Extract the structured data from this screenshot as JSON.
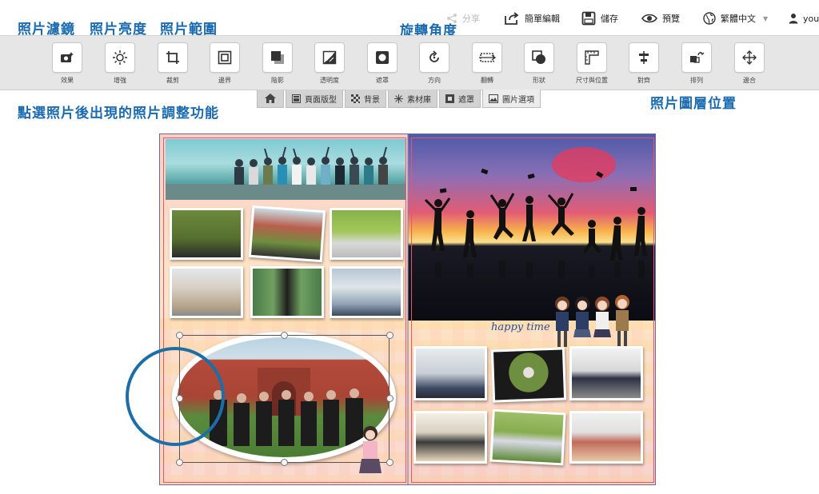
{
  "topbar": {
    "share": "分享",
    "quick_edit": "簡單編輯",
    "save": "儲存",
    "preview": "預覽",
    "language": "繁體中文",
    "user": "you"
  },
  "annotations": {
    "filters": "照片濾鏡",
    "brightness": "照片亮度",
    "range": "照片範圍",
    "rotation": "旋轉角度",
    "adjust": "點選照片後出現的照片調整功能",
    "layer": "照片圖層位置"
  },
  "toolbar": [
    {
      "label": "效果",
      "icon": "camera-effect-icon"
    },
    {
      "label": "增強",
      "icon": "brightness-icon"
    },
    {
      "label": "裁剪",
      "icon": "crop-icon"
    },
    {
      "label": "邊界",
      "icon": "border-icon"
    },
    {
      "label": "陰影",
      "icon": "shadow-icon"
    },
    {
      "label": "透明度",
      "icon": "opacity-icon"
    },
    {
      "label": "遮罩",
      "icon": "mask-icon"
    },
    {
      "label": "方向",
      "icon": "rotate-icon"
    },
    {
      "label": "翻轉",
      "icon": "flip-icon"
    },
    {
      "label": "形狀",
      "icon": "shape-icon"
    },
    {
      "label": "尺寸與位置",
      "icon": "ruler-icon"
    },
    {
      "label": "對齊",
      "icon": "align-icon"
    },
    {
      "label": "排列",
      "icon": "arrange-icon"
    },
    {
      "label": "邊合",
      "icon": "move-icon"
    }
  ],
  "tabs": [
    {
      "label": "",
      "icon": "home-icon"
    },
    {
      "label": "頁面版型",
      "icon": "layout-icon"
    },
    {
      "label": "背景",
      "icon": "checker-icon"
    },
    {
      "label": "素材庫",
      "icon": "sparkle-icon"
    },
    {
      "label": "遮罩",
      "icon": "mask-tab-icon"
    },
    {
      "label": "圖片選項",
      "icon": "image-icon"
    }
  ],
  "canvas": {
    "happy_text": "happy time"
  },
  "colors": {
    "annotation": "#1b6bb0",
    "bleed_line": "#e4586a",
    "toolbar_bg": "#e6e6e6"
  }
}
